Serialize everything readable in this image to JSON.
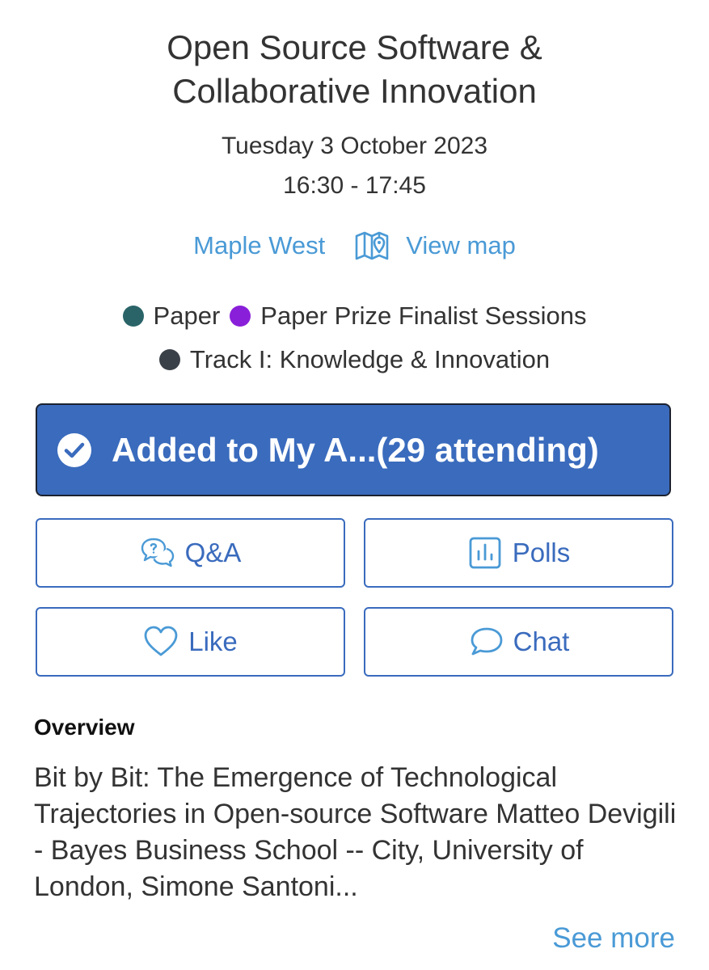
{
  "session": {
    "title_line1": "Open Source Software &",
    "title_line2": "Collaborative Innovation",
    "date": "Tuesday 3 October 2023",
    "time": "16:30 - 17:45"
  },
  "location": {
    "name": "Maple West",
    "map_label": "View map",
    "map_icon": "map-pin-icon"
  },
  "tags": [
    {
      "label": "Paper",
      "color": "#2a6468"
    },
    {
      "label": "Paper Prize Finalist Sessions",
      "color": "#8a1fd9"
    },
    {
      "label": "Track I: Knowledge & Innovation",
      "color": "#3a4048"
    }
  ],
  "attend": {
    "label": "Added to My A...(29 attending)",
    "icon": "check-circle-icon",
    "color": "#3a6bbd"
  },
  "actions": {
    "qa": {
      "label": "Q&A",
      "icon": "qa-bubbles-icon"
    },
    "polls": {
      "label": "Polls",
      "icon": "bar-chart-icon"
    },
    "like": {
      "label": "Like",
      "icon": "heart-icon"
    },
    "chat": {
      "label": "Chat",
      "icon": "chat-bubble-icon"
    }
  },
  "overview": {
    "heading": "Overview",
    "text": "Bit by Bit: The Emergence of Technological Trajectories in Open-source Software Matteo Devigili - Bayes Business School -- City, University of London, Simone Santoni...",
    "see_more": "See more"
  }
}
